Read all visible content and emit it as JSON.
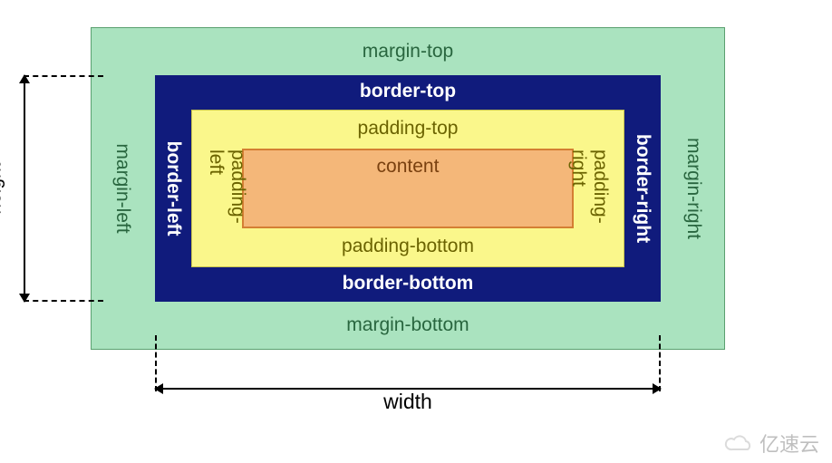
{
  "box_model": {
    "margin": {
      "top": "margin-top",
      "right": "margin-right",
      "bottom": "margin-bottom",
      "left": "margin-left"
    },
    "border": {
      "top": "border-top",
      "right": "border-right",
      "bottom": "border-bottom",
      "left": "border-left"
    },
    "padding": {
      "top": "padding-top",
      "right": "padding-right",
      "bottom": "padding-bottom",
      "left": "padding-left"
    },
    "content": {
      "label": "content"
    }
  },
  "dimensions": {
    "height_label": "height",
    "width_label": "width"
  },
  "colors": {
    "margin_bg": "#aae3bf",
    "border_bg": "#101b7c",
    "padding_bg": "#faf78b",
    "content_bg": "#f4b779"
  },
  "watermark": {
    "text": "亿速云"
  }
}
